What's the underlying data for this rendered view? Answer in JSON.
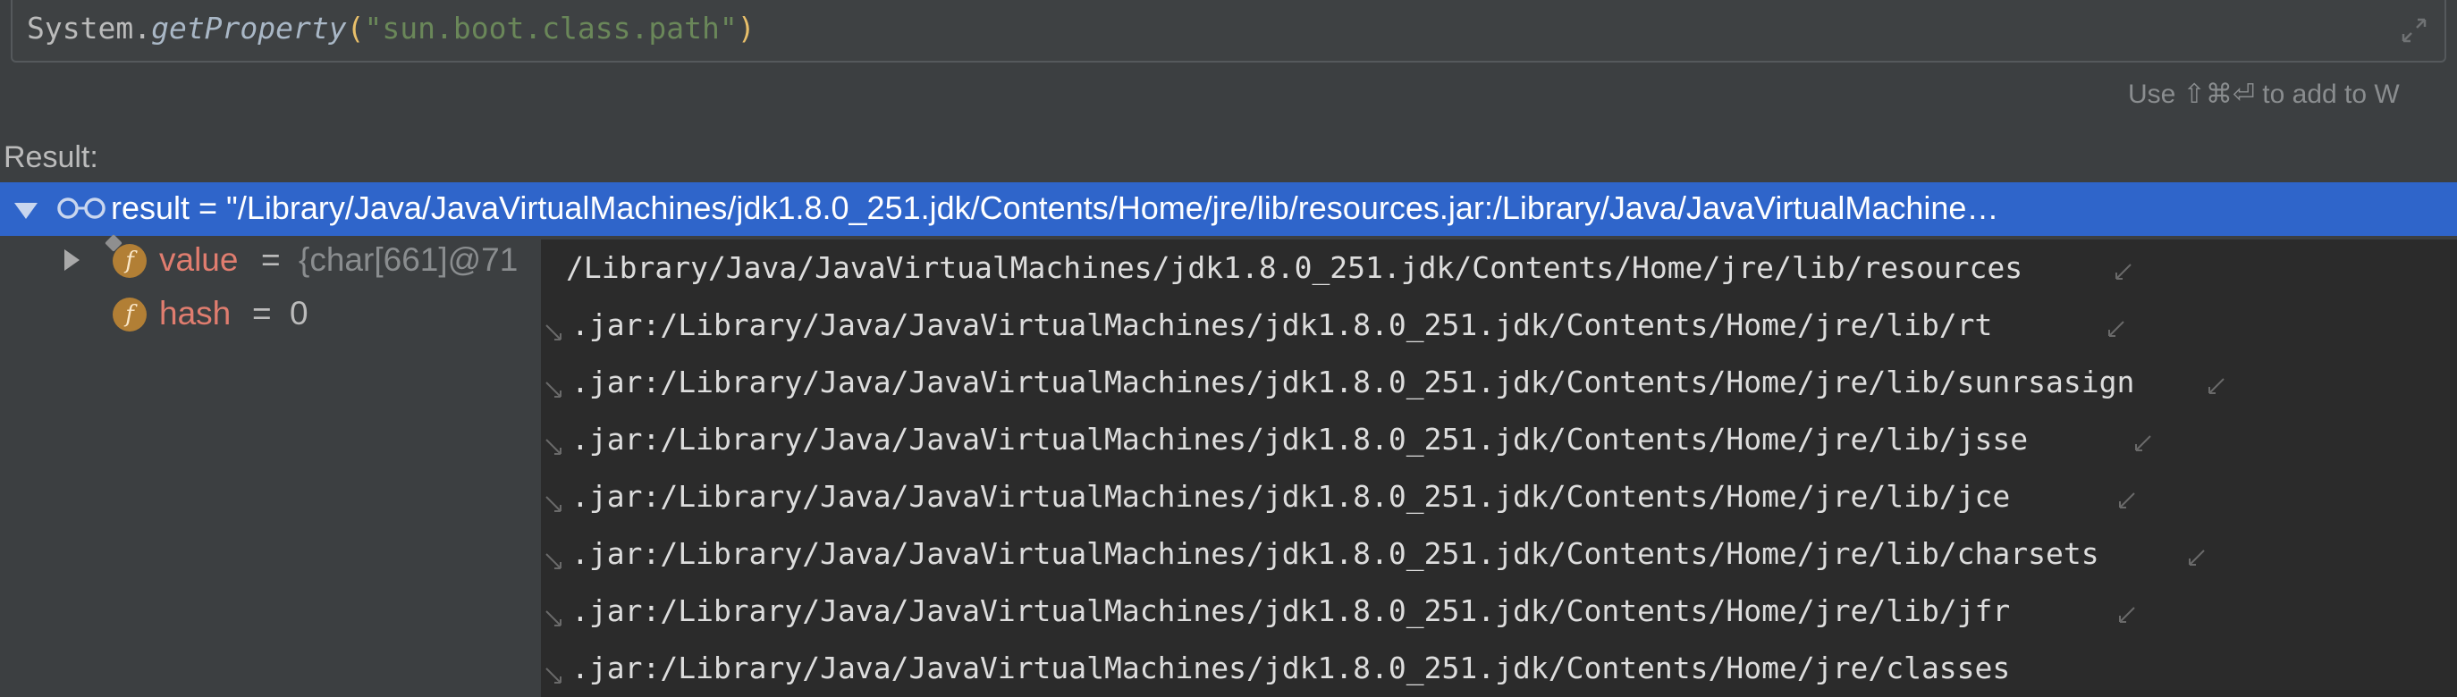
{
  "expression": {
    "prefix": "System.",
    "method": "getProperty",
    "open_paren": "(",
    "string": "\"sun.boot.class.path\"",
    "close_paren": ")"
  },
  "hint": "Use ⇧⌘⏎ to add to W",
  "result_label": "Result:",
  "tree": {
    "result_text": "result = \"/Library/Java/JavaVirtualMachines/jdk1.8.0_251.jdk/Contents/Home/jre/lib/resources.jar:/Library/Java/JavaVirtualMachine…",
    "value": {
      "name": "value",
      "eq": "=",
      "val": "{char[661]@71"
    },
    "hash": {
      "name": "hash",
      "eq": "=",
      "val": "0"
    }
  },
  "popup_lines": [
    "/Library/Java/JavaVirtualMachines/jdk1.8.0_251.jdk/Contents/Home/jre/lib/resources",
    ".jar:/Library/Java/JavaVirtualMachines/jdk1.8.0_251.jdk/Contents/Home/jre/lib/rt",
    ".jar:/Library/Java/JavaVirtualMachines/jdk1.8.0_251.jdk/Contents/Home/jre/lib/sunrsasign",
    ".jar:/Library/Java/JavaVirtualMachines/jdk1.8.0_251.jdk/Contents/Home/jre/lib/jsse",
    ".jar:/Library/Java/JavaVirtualMachines/jdk1.8.0_251.jdk/Contents/Home/jre/lib/jce",
    ".jar:/Library/Java/JavaVirtualMachines/jdk1.8.0_251.jdk/Contents/Home/jre/lib/charsets",
    ".jar:/Library/Java/JavaVirtualMachines/jdk1.8.0_251.jdk/Contents/Home/jre/lib/jfr",
    ".jar:/Library/Java/JavaVirtualMachines/jdk1.8.0_251.jdk/Contents/Home/jre/classes"
  ],
  "icons": {
    "expand": "expand-icon",
    "watch": "glasses-icon",
    "field": "field-icon",
    "wrap": "soft-wrap-icon"
  },
  "colors": {
    "background": "#3c3f41",
    "selection": "#2f65ca",
    "field_name": "#e07d6f",
    "string": "#6a8759",
    "paren": "#e8bf6a"
  }
}
